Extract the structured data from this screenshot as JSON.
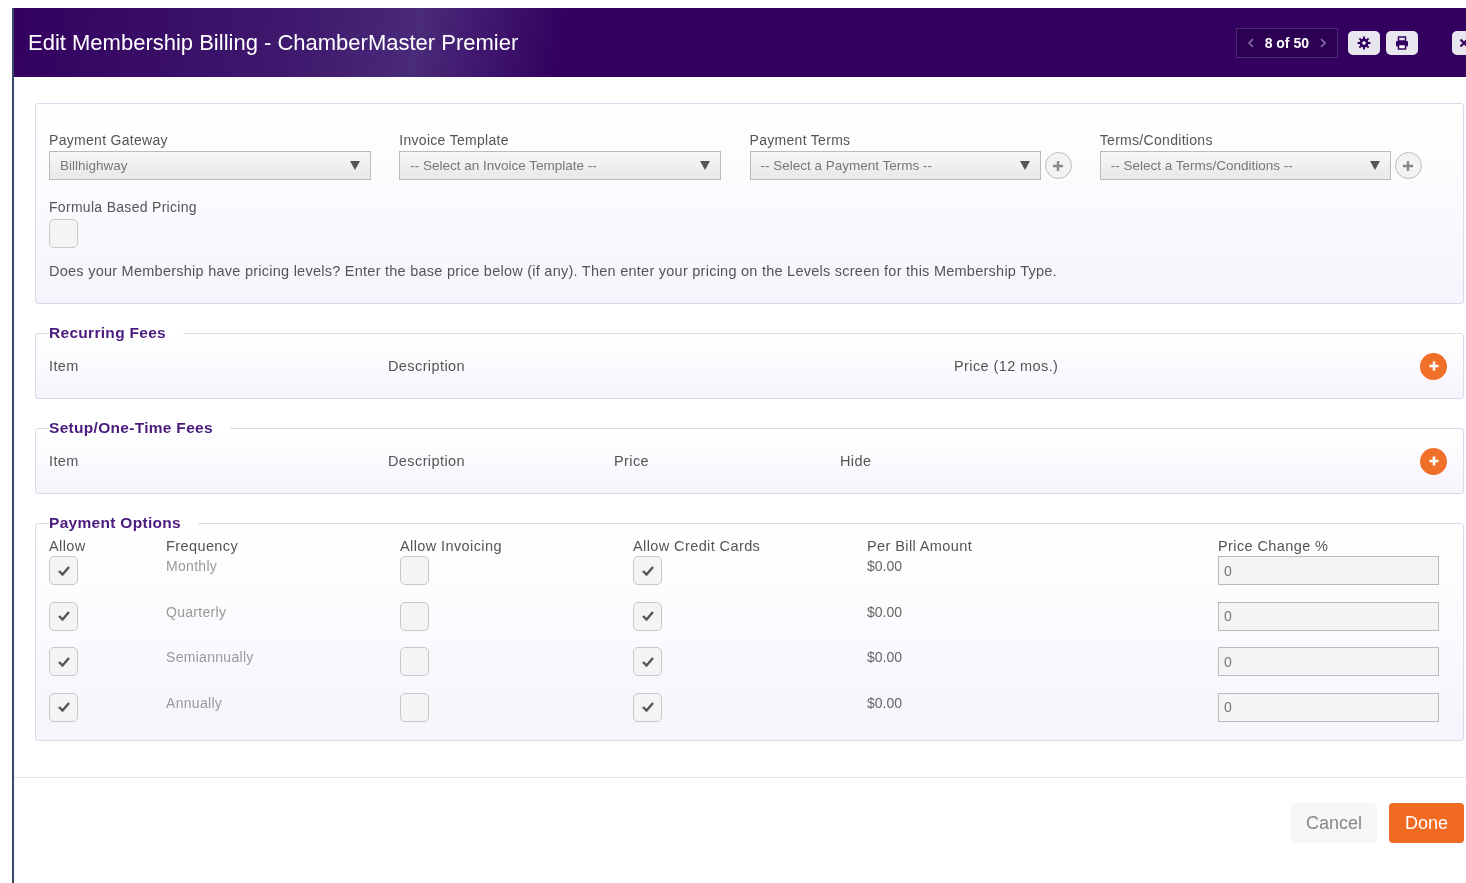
{
  "header": {
    "title": "Edit Membership Billing - ChamberMaster Premier",
    "pager": "8 of 50"
  },
  "selects": [
    {
      "label": "Payment Gateway",
      "value": "Billhighway",
      "has_add": false
    },
    {
      "label": "Invoice Template",
      "value": "-- Select an Invoice Template --",
      "has_add": false
    },
    {
      "label": "Payment Terms",
      "value": "-- Select a Payment Terms --",
      "has_add": true
    },
    {
      "label": "Terms/Conditions",
      "value": "-- Select a Terms/Conditions --",
      "has_add": true
    }
  ],
  "formula": {
    "label": "Formula Based Pricing",
    "checked": false
  },
  "note": "Does your Membership have pricing levels? Enter the base price below (if any). Then enter your pricing on the Levels screen for this Membership Type.",
  "recurring_fees": {
    "title": "Recurring Fees",
    "columns": [
      "Item",
      "Description",
      "Price (12 mos.)"
    ]
  },
  "setup_fees": {
    "title": "Setup/One-Time Fees",
    "columns": [
      "Item",
      "Description",
      "Price",
      "Hide"
    ]
  },
  "payment_options": {
    "title": "Payment Options",
    "columns": [
      "Allow",
      "Frequency",
      "Allow Invoicing",
      "Allow Credit Cards",
      "Per Bill Amount",
      "Price Change %"
    ],
    "rows": [
      {
        "allow": true,
        "frequency": "Monthly",
        "invoicing": false,
        "credit_cards": true,
        "amount": "$0.00",
        "price_change": "0"
      },
      {
        "allow": true,
        "frequency": "Quarterly",
        "invoicing": false,
        "credit_cards": true,
        "amount": "$0.00",
        "price_change": "0"
      },
      {
        "allow": true,
        "frequency": "Semiannually",
        "invoicing": false,
        "credit_cards": true,
        "amount": "$0.00",
        "price_change": "0"
      },
      {
        "allow": true,
        "frequency": "Annually",
        "invoicing": false,
        "credit_cards": true,
        "amount": "$0.00",
        "price_change": "0"
      }
    ]
  },
  "buttons": {
    "cancel": "Cancel",
    "done": "Done"
  }
}
